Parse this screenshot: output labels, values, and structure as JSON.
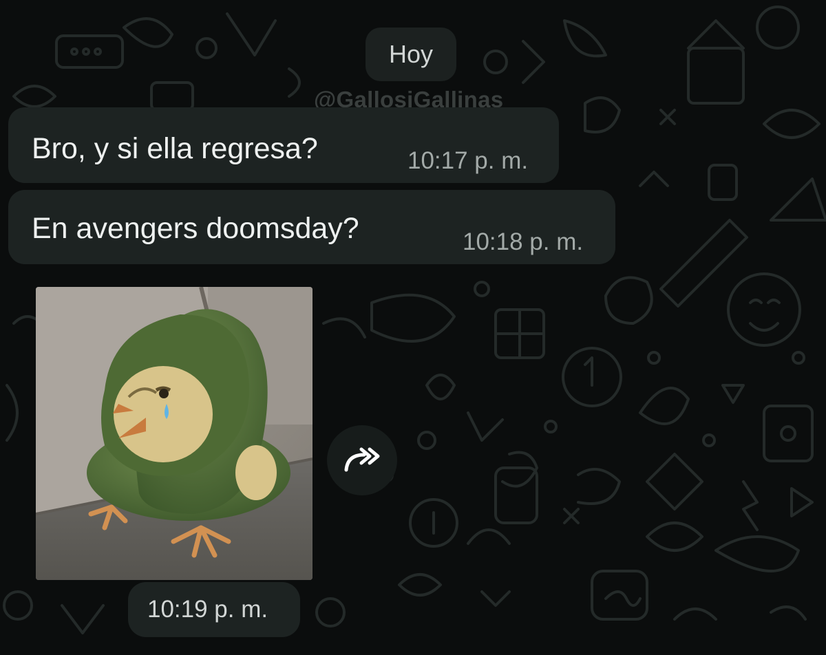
{
  "chat": {
    "date_divider": "Hoy",
    "watermark": "@GallosiGallinas",
    "messages": [
      {
        "text": "Bro, y si ella regresa?",
        "time": "10:17 p. m."
      },
      {
        "text": "En avengers doomsday?",
        "time": "10:18 p. m."
      }
    ],
    "sticker": {
      "icon": "sad-chick-in-green-hoodie-sticker",
      "time": "10:19 p. m."
    },
    "forward_icon": "forward-icon"
  },
  "colors": {
    "background": "#0b0d0d",
    "bubble": "#1d2322",
    "text": "#eef1f0",
    "timestamp": "#a3aaa8"
  }
}
